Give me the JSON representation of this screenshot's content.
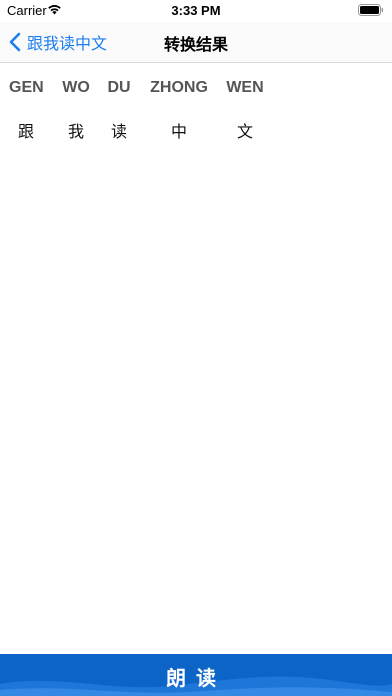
{
  "status_bar": {
    "carrier": "Carrier",
    "time": "3:33 PM"
  },
  "nav": {
    "back_label": "跟我读中文",
    "title": "转换结果"
  },
  "results": [
    {
      "pinyin": "GEN",
      "hanzi": "跟"
    },
    {
      "pinyin": "WO",
      "hanzi": "我"
    },
    {
      "pinyin": "DU",
      "hanzi": "读"
    },
    {
      "pinyin": "ZHONG",
      "hanzi": "中"
    },
    {
      "pinyin": "WEN",
      "hanzi": "文"
    }
  ],
  "read_button": {
    "label": "朗读"
  },
  "colors": {
    "accent": "#1a7ef0",
    "button_bg": "#0b64c6",
    "pinyin": "#555555"
  }
}
